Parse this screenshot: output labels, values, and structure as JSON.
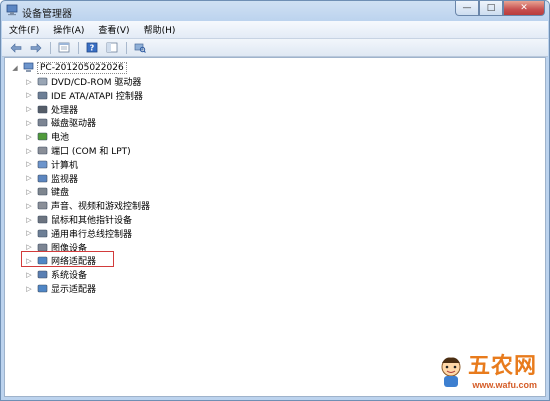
{
  "window": {
    "title": "设备管理器",
    "buttons": {
      "minimize": "—",
      "maximize": "□",
      "close": "✕"
    }
  },
  "menu": [
    {
      "label": "文件(F)"
    },
    {
      "label": "操作(A)"
    },
    {
      "label": "查看(V)"
    },
    {
      "label": "帮助(H)"
    }
  ],
  "toolbar": {
    "back_icon": "back-arrow-icon",
    "forward_icon": "forward-arrow-icon",
    "buttons": [
      "properties-icon",
      "help-icon",
      "console-tree-icon",
      "scan-hardware-icon"
    ]
  },
  "tree": {
    "root": "PC-201205022026",
    "items": [
      {
        "label": "DVD/CD-ROM 驱动器",
        "icon": "dvd-drive-icon"
      },
      {
        "label": "IDE ATA/ATAPI 控制器",
        "icon": "ide-controller-icon"
      },
      {
        "label": "处理器",
        "icon": "processor-icon"
      },
      {
        "label": "磁盘驱动器",
        "icon": "disk-drive-icon"
      },
      {
        "label": "电池",
        "icon": "battery-icon"
      },
      {
        "label": "端口 (COM 和 LPT)",
        "icon": "port-icon"
      },
      {
        "label": "计算机",
        "icon": "computer-icon"
      },
      {
        "label": "监视器",
        "icon": "monitor-icon"
      },
      {
        "label": "键盘",
        "icon": "keyboard-icon"
      },
      {
        "label": "声音、视频和游戏控制器",
        "icon": "sound-icon"
      },
      {
        "label": "鼠标和其他指针设备",
        "icon": "mouse-icon"
      },
      {
        "label": "通用串行总线控制器",
        "icon": "usb-icon"
      },
      {
        "label": "图像设备",
        "icon": "imaging-icon"
      },
      {
        "label": "网络适配器",
        "icon": "network-adapter-icon"
      },
      {
        "label": "系统设备",
        "icon": "system-device-icon"
      },
      {
        "label": "显示适配器",
        "icon": "display-adapter-icon"
      }
    ]
  },
  "watermark": {
    "title": "五农网",
    "url": "www.wafu.com"
  },
  "colors": {
    "highlight_box": "#d23b3b",
    "title_gradient_top": "#cfe0f3",
    "tree_bg": "#ffffff"
  }
}
